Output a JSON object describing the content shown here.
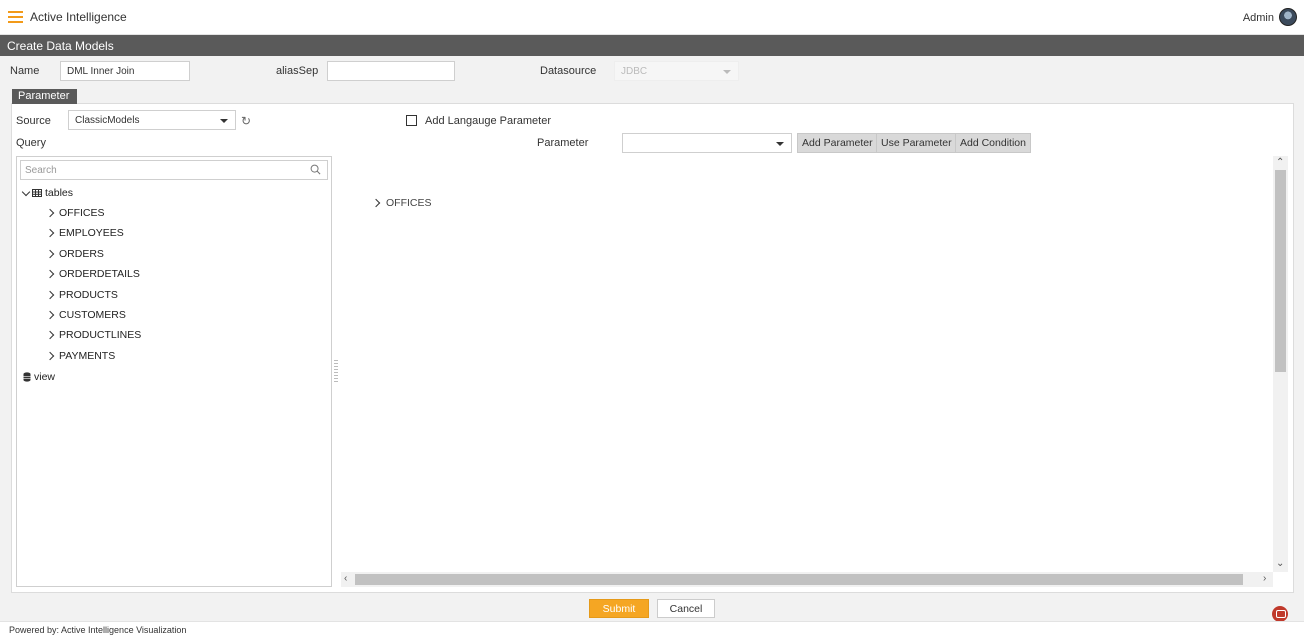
{
  "app": {
    "title": "Active Intelligence",
    "user": "Admin"
  },
  "page": {
    "title": "Create Data Models"
  },
  "form": {
    "name_label": "Name",
    "name_value": "DML Inner Join",
    "alias_label": "aliasSep",
    "alias_value": "",
    "datasource_label": "Datasource",
    "datasource_value": "JDBC"
  },
  "tabs": {
    "parameter": "Parameter"
  },
  "source": {
    "label": "Source",
    "value": "ClassicModels"
  },
  "add_language_parameter": {
    "label": "Add Langauge Parameter",
    "checked": false
  },
  "query": {
    "label": "Query"
  },
  "parameter": {
    "label": "Parameter",
    "value": "",
    "add_parameter": "Add Parameter",
    "use_parameter": "Use Parameter",
    "add_condition": "Add Condition"
  },
  "tree": {
    "search_placeholder": "Search",
    "tables_label": "tables",
    "tables": [
      "OFFICES",
      "EMPLOYEES",
      "ORDERS",
      "ORDERDETAILS",
      "PRODUCTS",
      "CUSTOMERS",
      "PRODUCTLINES",
      "PAYMENTS"
    ],
    "view_label": "view"
  },
  "canvas": {
    "items": [
      "OFFICES"
    ]
  },
  "actions": {
    "submit": "Submit",
    "cancel": "Cancel"
  },
  "footer": {
    "text": "Powered by: Active Intelligence Visualization"
  },
  "colors": {
    "accent": "#f5a623",
    "header_bar": "#5a5a5a"
  }
}
